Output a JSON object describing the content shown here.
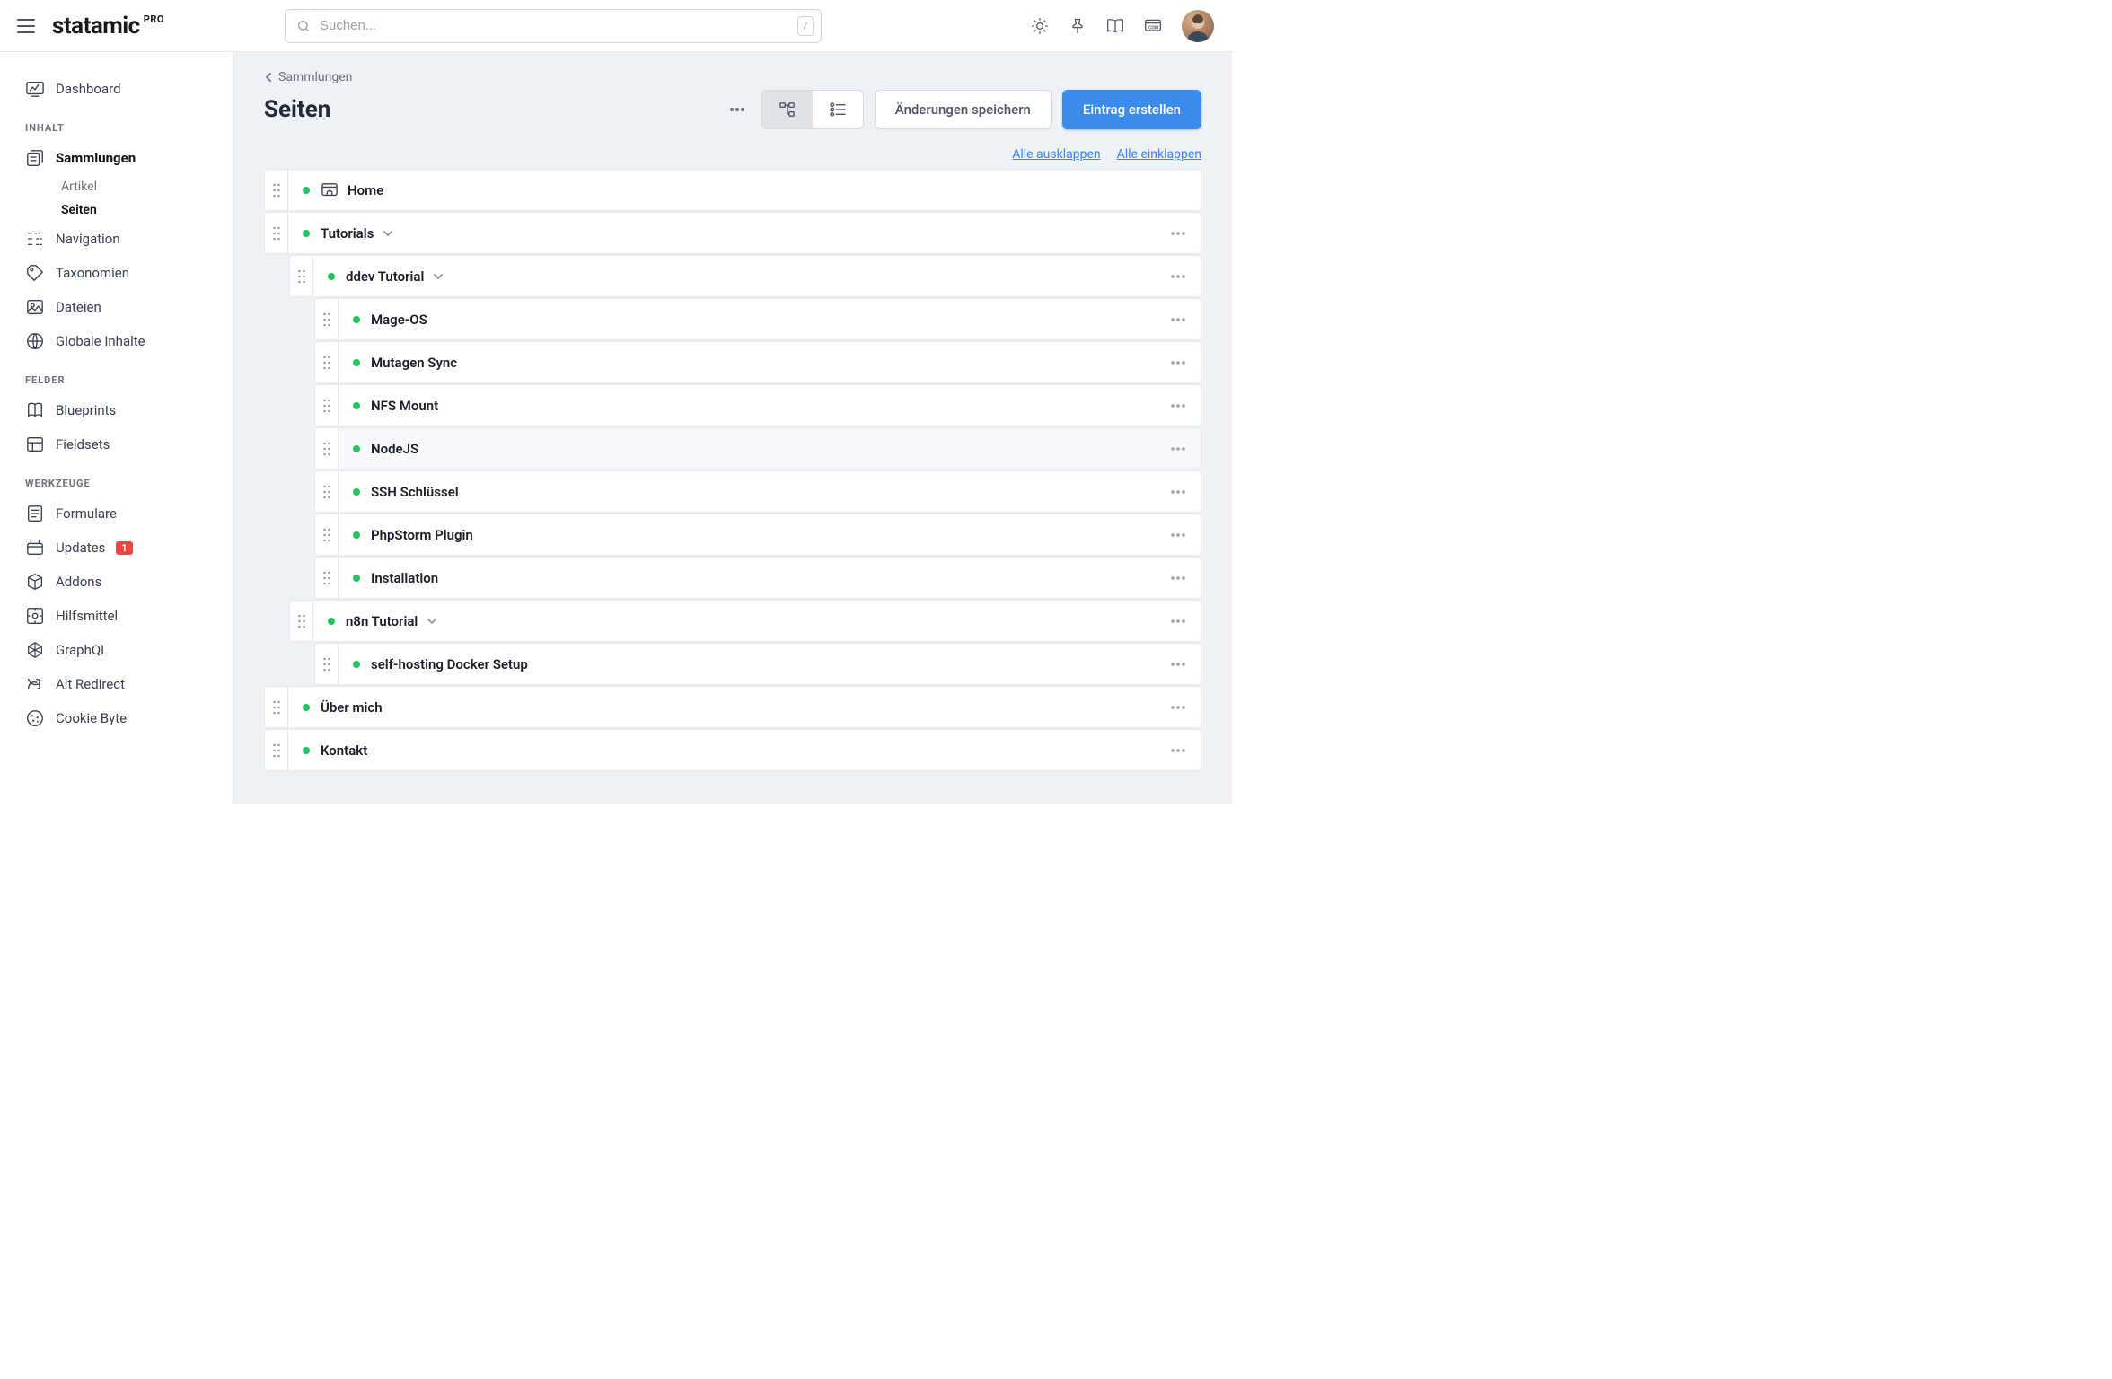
{
  "app": {
    "brand": "statamic",
    "edition": "PRO"
  },
  "search": {
    "placeholder": "Suchen...",
    "shortcut": "/"
  },
  "sidebar": {
    "top": {
      "dashboard": "Dashboard"
    },
    "groups": [
      {
        "label": "INHALT",
        "items": [
          {
            "key": "sammlungen",
            "label": "Sammlungen",
            "active": true,
            "children": [
              {
                "key": "artikel",
                "label": "Artikel",
                "active": false
              },
              {
                "key": "seiten",
                "label": "Seiten",
                "active": true
              }
            ]
          },
          {
            "key": "navigation",
            "label": "Navigation"
          },
          {
            "key": "taxonomien",
            "label": "Taxonomien"
          },
          {
            "key": "dateien",
            "label": "Dateien"
          },
          {
            "key": "globale",
            "label": "Globale Inhalte"
          }
        ]
      },
      {
        "label": "FELDER",
        "items": [
          {
            "key": "blueprints",
            "label": "Blueprints"
          },
          {
            "key": "fieldsets",
            "label": "Fieldsets"
          }
        ]
      },
      {
        "label": "WERKZEUGE",
        "items": [
          {
            "key": "formulare",
            "label": "Formulare"
          },
          {
            "key": "updates",
            "label": "Updates",
            "badge": "1"
          },
          {
            "key": "addons",
            "label": "Addons"
          },
          {
            "key": "hilfsmittel",
            "label": "Hilfsmittel"
          },
          {
            "key": "graphql",
            "label": "GraphQL"
          },
          {
            "key": "altredirect",
            "label": "Alt Redirect"
          },
          {
            "key": "cookiebyte",
            "label": "Cookie Byte"
          }
        ]
      }
    ]
  },
  "main": {
    "breadcrumb": {
      "parent": "Sammlungen"
    },
    "title": "Seiten",
    "buttons": {
      "save": "Änderungen speichern",
      "create": "Eintrag erstellen"
    },
    "links": {
      "expand_all": "Alle ausklappen",
      "collapse_all": "Alle einklappen"
    },
    "tree": [
      {
        "id": "home",
        "title": "Home",
        "depth": 0,
        "is_home": true,
        "has_children": false,
        "hovered": false,
        "show_actions": false
      },
      {
        "id": "tutorials",
        "title": "Tutorials",
        "depth": 0,
        "has_children": true,
        "hovered": false,
        "show_actions": true
      },
      {
        "id": "ddev",
        "title": "ddev Tutorial",
        "depth": 1,
        "has_children": true,
        "hovered": false,
        "show_actions": true
      },
      {
        "id": "mageos",
        "title": "Mage-OS",
        "depth": 2,
        "has_children": false,
        "hovered": false,
        "show_actions": true
      },
      {
        "id": "mutagen",
        "title": "Mutagen Sync",
        "depth": 2,
        "has_children": false,
        "hovered": false,
        "show_actions": true
      },
      {
        "id": "nfs",
        "title": "NFS Mount",
        "depth": 2,
        "has_children": false,
        "hovered": false,
        "show_actions": true
      },
      {
        "id": "nodejs",
        "title": "NodeJS",
        "depth": 2,
        "has_children": false,
        "hovered": true,
        "show_actions": true
      },
      {
        "id": "ssh",
        "title": "SSH Schlüssel",
        "depth": 2,
        "has_children": false,
        "hovered": false,
        "show_actions": true
      },
      {
        "id": "phpstorm",
        "title": "PhpStorm Plugin",
        "depth": 2,
        "has_children": false,
        "hovered": false,
        "show_actions": true
      },
      {
        "id": "install",
        "title": "Installation",
        "depth": 2,
        "has_children": false,
        "hovered": false,
        "show_actions": true
      },
      {
        "id": "n8n",
        "title": "n8n Tutorial",
        "depth": 1,
        "has_children": true,
        "hovered": false,
        "show_actions": true
      },
      {
        "id": "selfhost",
        "title": "self-hosting Docker Setup",
        "depth": 2,
        "has_children": false,
        "hovered": false,
        "show_actions": true
      },
      {
        "id": "ueber",
        "title": "Über mich",
        "depth": 0,
        "has_children": false,
        "hovered": false,
        "show_actions": true
      },
      {
        "id": "kontakt",
        "title": "Kontakt",
        "depth": 0,
        "has_children": false,
        "hovered": false,
        "show_actions": true
      }
    ]
  }
}
